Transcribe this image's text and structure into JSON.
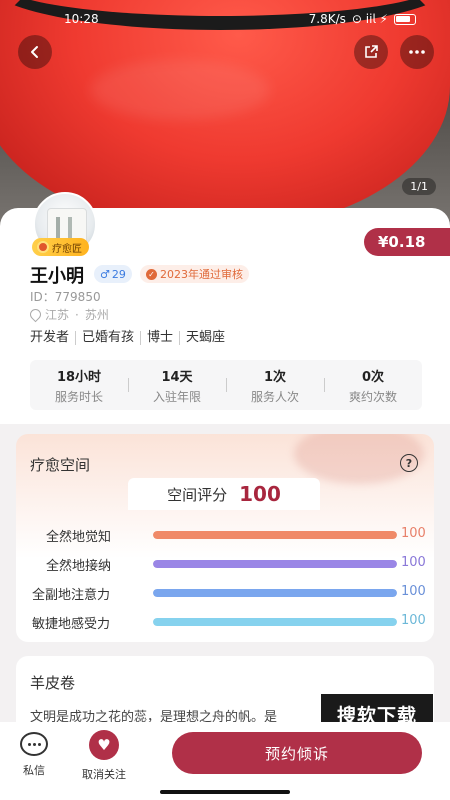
{
  "status_bar": {
    "time": "10:28",
    "net": "7.8K/s",
    "signal": "⊙ 𝗂𝗂𝗅 ⚡"
  },
  "hero": {
    "counter": "1/1"
  },
  "profile": {
    "badge": "疗愈匠",
    "price": "¥0.18",
    "name": "王小明",
    "gender_symbol": "♂",
    "age": "29",
    "review": "2023年通过审核",
    "review_check": "✓",
    "id": "ID：779850",
    "location_province": "江苏",
    "location_dot": "·",
    "location_city": "苏州",
    "tags": [
      "开发者",
      "已婚有孩",
      "博士",
      "天蝎座"
    ],
    "stats": [
      {
        "value": "18小时",
        "label": "服务时长"
      },
      {
        "value": "14天",
        "label": "入驻年限"
      },
      {
        "value": "1次",
        "label": "服务人次"
      },
      {
        "value": "0次",
        "label": "爽约次数"
      }
    ]
  },
  "healing_space": {
    "title": "疗愈空间",
    "help": "?",
    "score_label": "空间评分",
    "score": "100",
    "bars": [
      {
        "label": "全然地觉知",
        "value": 100,
        "display": "100",
        "color": "#f08a68",
        "text_color": "#e8806a"
      },
      {
        "label": "全然地接纳",
        "value": 100,
        "display": "100",
        "color": "#9a86e6",
        "text_color": "#8a78d8"
      },
      {
        "label": "全副地注意力",
        "value": 100,
        "display": "100",
        "color": "#7aa6ee",
        "text_color": "#6a90d8"
      },
      {
        "label": "敏捷地感受力",
        "value": 100,
        "display": "100",
        "color": "#86d2ee",
        "text_color": "#6cb8d8"
      }
    ]
  },
  "parchment": {
    "title": "羊皮卷",
    "text": "文明是成功之花的蕊，是理想之舟的帆。是"
  },
  "watermark": "搜软下载",
  "bottom_bar": {
    "message_label": "私信",
    "unfollow_label": "取消关注",
    "book_label": "预约倾诉"
  },
  "colors": {
    "accent": "#b03048",
    "score": "#a8263e",
    "badge": "#ffb31f"
  }
}
